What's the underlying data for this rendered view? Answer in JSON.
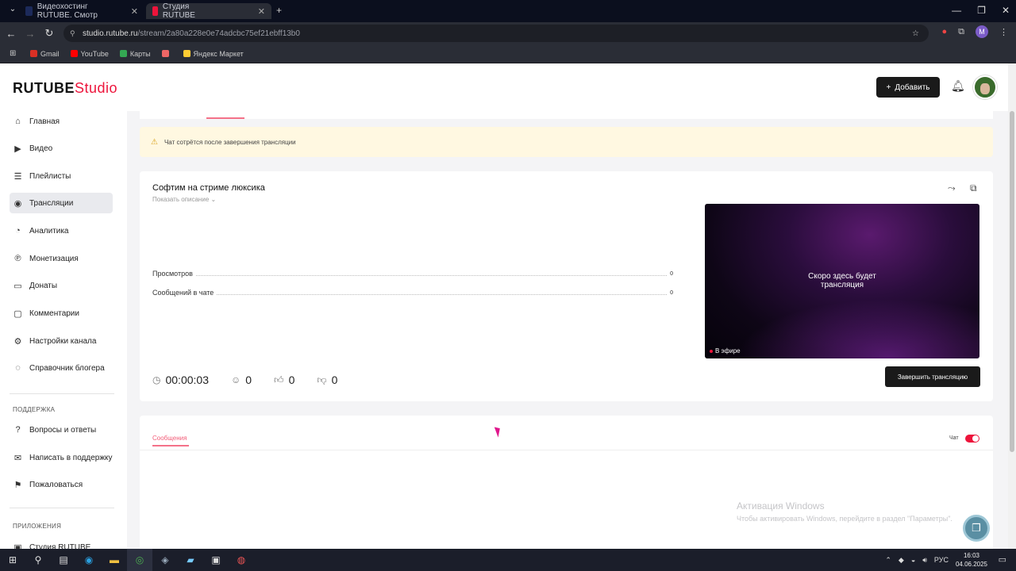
{
  "browser": {
    "tabs": [
      {
        "title": "Видеохостинг RUTUBE. Смотр",
        "active": false
      },
      {
        "title": "Студия RUTUBE",
        "active": true
      }
    ],
    "new_tab": "+",
    "url_host": "studio.rutube.ru",
    "url_path": "/stream/2a80a228e0e74adcbc75ef21ebff13b0",
    "profile_initial": "M",
    "bookmarks": [
      "Gmail",
      "YouTube",
      "Карты",
      "",
      "Яндекс Маркет"
    ]
  },
  "header": {
    "logo_main": "RUTUBE",
    "logo_studio": "Studio",
    "add_label": "Добавить"
  },
  "sidebar": {
    "items": [
      {
        "label": "Главная",
        "icon": "home-icon",
        "glyph": "⌂"
      },
      {
        "label": "Видео",
        "icon": "video-icon",
        "glyph": "▶"
      },
      {
        "label": "Плейлисты",
        "icon": "playlist-icon",
        "glyph": "☰"
      },
      {
        "label": "Трансляции",
        "icon": "broadcast-icon",
        "glyph": "◉"
      },
      {
        "label": "Аналитика",
        "icon": "analytics-icon",
        "glyph": "◔"
      },
      {
        "label": "Монетизация",
        "icon": "monetization-icon",
        "glyph": "℗"
      },
      {
        "label": "Донаты",
        "icon": "donate-icon",
        "glyph": "▭"
      },
      {
        "label": "Комментарии",
        "icon": "comments-icon",
        "glyph": "▢"
      },
      {
        "label": "Настройки канала",
        "icon": "settings-icon",
        "glyph": "⚙"
      },
      {
        "label": "Справочник блогера",
        "icon": "guide-icon",
        "glyph": "◌"
      }
    ],
    "support_heading": "ПОДДЕРЖКА",
    "support_items": [
      {
        "label": "Вопросы и ответы",
        "icon": "faq-icon",
        "glyph": "?"
      },
      {
        "label": "Написать в поддержку",
        "icon": "mail-icon",
        "glyph": "✉"
      },
      {
        "label": "Пожаловаться",
        "icon": "flag-icon",
        "glyph": "⚑"
      }
    ],
    "apps_heading": "ПРИЛОЖЕНИЯ",
    "apps_items": [
      {
        "label": "Студия RUTUBE",
        "icon": "app-icon",
        "glyph": "▣"
      }
    ]
  },
  "notice": {
    "text": "Чат сотрётся после завершения трансляции"
  },
  "stream": {
    "title": "Софтим на стриме люксика",
    "show_description": "Показать описание ⌄",
    "stats": [
      {
        "label": "Просмотров",
        "value": "0"
      },
      {
        "label": "Сообщений в чате",
        "value": "0"
      }
    ],
    "player_text_line1": "Скоро здесь будет",
    "player_text_line2": "трансляция",
    "live_label": "В эфире",
    "duration": "00:00:03",
    "viewers": "0",
    "likes": "0",
    "dislikes": "0",
    "end_button": "Завершить трансляцию"
  },
  "chat": {
    "tab_label": "Сообщения",
    "toggle_label": "Чат",
    "toggle_on": true
  },
  "windows_activation": {
    "title": "Активация Windows",
    "subtitle": "Чтобы активировать Windows, перейдите в раздел \"Параметры\"."
  },
  "taskbar": {
    "language": "РУС",
    "time": "16:03",
    "date": "04.06.2025"
  },
  "colors": {
    "accent": "#ed143b",
    "dark_button": "#1a1a1a",
    "notice_bg": "#fff8e1"
  }
}
